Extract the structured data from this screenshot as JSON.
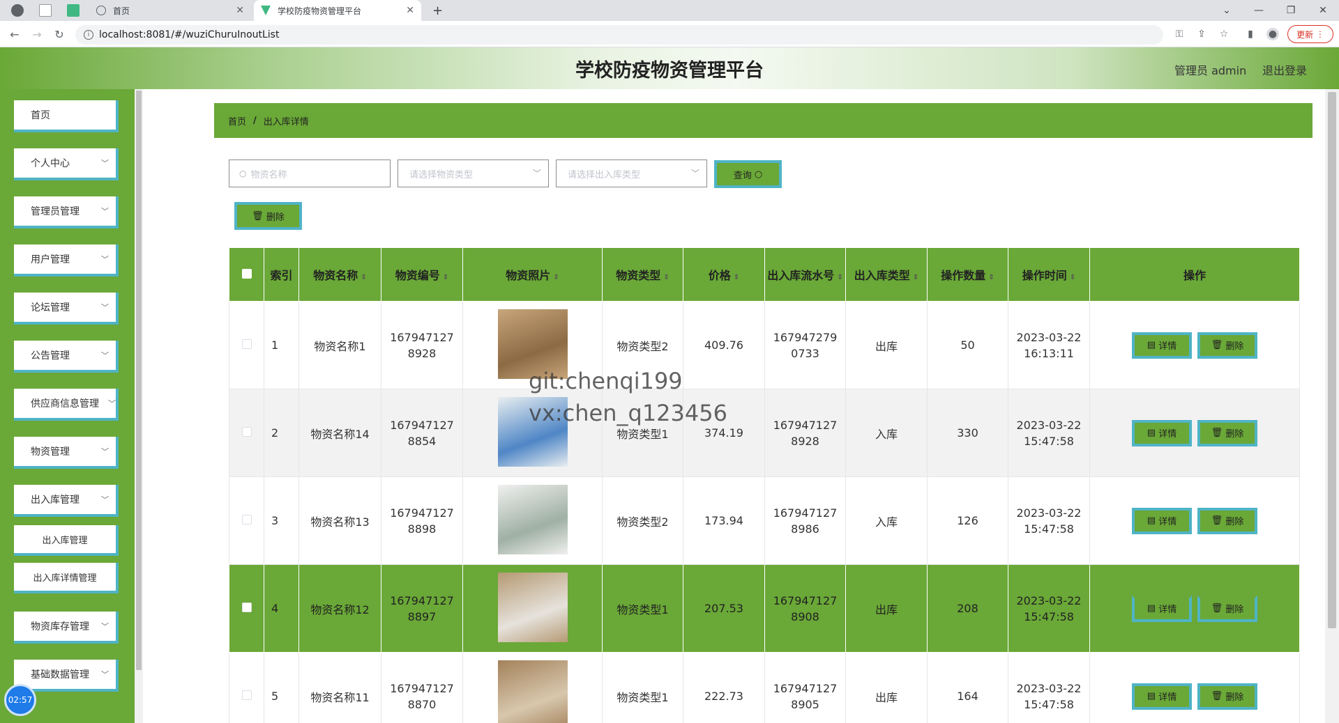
{
  "browser": {
    "tabs": [
      {
        "label": "首页"
      },
      {
        "label": "学校防疫物资管理平台"
      }
    ],
    "url": "localhost:8081/#/wuziChuruInoutList",
    "update_label": "更新"
  },
  "header": {
    "title": "学校防疫物资管理平台",
    "user": "管理员 admin",
    "logout": "退出登录"
  },
  "sidebar": {
    "items": [
      {
        "label": "首页"
      },
      {
        "label": "个人中心"
      },
      {
        "label": "管理员管理"
      },
      {
        "label": "用户管理"
      },
      {
        "label": "论坛管理"
      },
      {
        "label": "公告管理"
      },
      {
        "label": "供应商信息管理"
      },
      {
        "label": "物资管理"
      },
      {
        "label": "出入库管理"
      },
      {
        "label": "出入库管理"
      },
      {
        "label": "出入库详情管理"
      },
      {
        "label": "物资库存管理"
      },
      {
        "label": "基础数据管理"
      }
    ]
  },
  "timer": "02:57",
  "breadcrumb": {
    "home": "首页",
    "sep": "/",
    "current": "出入库详情"
  },
  "filters": {
    "name_placeholder": "物资名称",
    "type_placeholder": "请选择物资类型",
    "io_placeholder": "请选择出入库类型",
    "query_label": "查询",
    "delete_label": "删除"
  },
  "table": {
    "headers": {
      "index": "索引",
      "name": "物资名称",
      "code": "物资编号",
      "photo": "物资照片",
      "type": "物资类型",
      "price": "价格",
      "serial": "出入库流水号",
      "io_type": "出入库类型",
      "qty": "操作数量",
      "time": "操作时间",
      "ops": "操作"
    },
    "detail_label": "详情",
    "delete_label": "删除",
    "rows": [
      {
        "index": "1",
        "name": "物资名称1",
        "code": "1679471278928",
        "type": "物资类型2",
        "price": "409.76",
        "serial": "1679472790733",
        "io_type": "出库",
        "qty": "50",
        "date": "2023-03-22",
        "time": "16:13:11"
      },
      {
        "index": "2",
        "name": "物资名称14",
        "code": "1679471278854",
        "type": "物资类型1",
        "price": "374.19",
        "serial": "1679471278928",
        "io_type": "入库",
        "qty": "330",
        "date": "2023-03-22",
        "time": "15:47:58"
      },
      {
        "index": "3",
        "name": "物资名称13",
        "code": "1679471278898",
        "type": "物资类型2",
        "price": "173.94",
        "serial": "1679471278986",
        "io_type": "入库",
        "qty": "126",
        "date": "2023-03-22",
        "time": "15:47:58"
      },
      {
        "index": "4",
        "name": "物资名称12",
        "code": "1679471278897",
        "type": "物资类型1",
        "price": "207.53",
        "serial": "1679471278908",
        "io_type": "出库",
        "qty": "208",
        "date": "2023-03-22",
        "time": "15:47:58"
      },
      {
        "index": "5",
        "name": "物资名称11",
        "code": "1679471278870",
        "type": "物资类型1",
        "price": "222.73",
        "serial": "1679471278905",
        "io_type": "出库",
        "qty": "164",
        "date": "2023-03-22",
        "time": "15:47:58"
      }
    ]
  },
  "watermark": {
    "line1": "git:chenqi199",
    "line2": "vx:chen_q123456"
  },
  "colors": {
    "accent": "#6aa837",
    "border_accent": "#4fb4c6"
  }
}
